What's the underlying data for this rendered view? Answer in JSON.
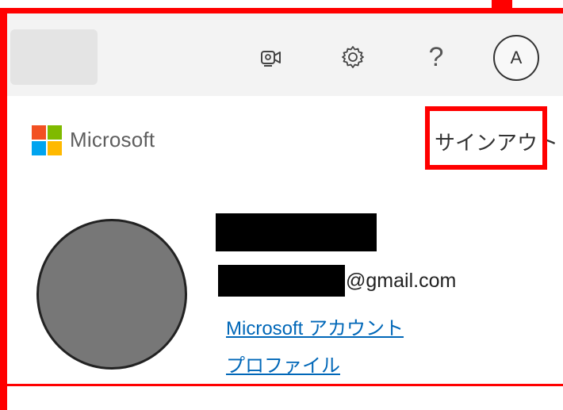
{
  "header": {
    "meet_icon": "meet-now-icon",
    "settings_icon": "gear-icon",
    "help_icon": "question-mark-icon",
    "help_glyph": "?",
    "avatar_initial": "A"
  },
  "account_panel": {
    "brand_name": "Microsoft",
    "brand_colors": [
      "#f25022",
      "#7fba00",
      "#00a4ef",
      "#ffb900"
    ],
    "sign_out_label": "サインアウト",
    "email_suffix": "@gmail.com",
    "account_link": "Microsoft アカウント",
    "profile_link": "プロファイル"
  },
  "annotation": {
    "highlight_color": "#ff0000"
  }
}
